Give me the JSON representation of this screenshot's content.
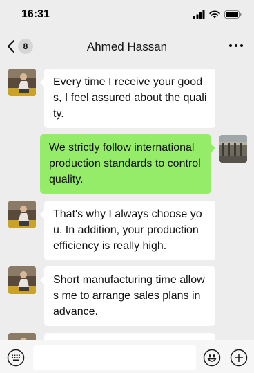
{
  "status_bar": {
    "time": "16:31"
  },
  "nav": {
    "back_badge": "8",
    "title": "Ahmed Hassan"
  },
  "icons": {
    "back": "chevron-left-icon",
    "more": "more-dots-icon",
    "keyboard": "keyboard-icon",
    "emoji": "emoji-icon",
    "plus": "plus-icon"
  },
  "colors": {
    "background": "#ededed",
    "incoming_bubble": "#ffffff",
    "outgoing_bubble": "#95ec69"
  },
  "messages": [
    {
      "sender": "contact",
      "text": "Every time I receive your goods, I feel assured about the quality."
    },
    {
      "sender": "me",
      "text": "We strictly follow international production standards to control quality."
    },
    {
      "sender": "contact",
      "text": "That's why I always choose you. In addition, your production efficiency is really high."
    },
    {
      "sender": "contact",
      "text": "Short manufacturing time allows me to arrange sales plans in advance."
    }
  ],
  "composer": {
    "value": ""
  }
}
